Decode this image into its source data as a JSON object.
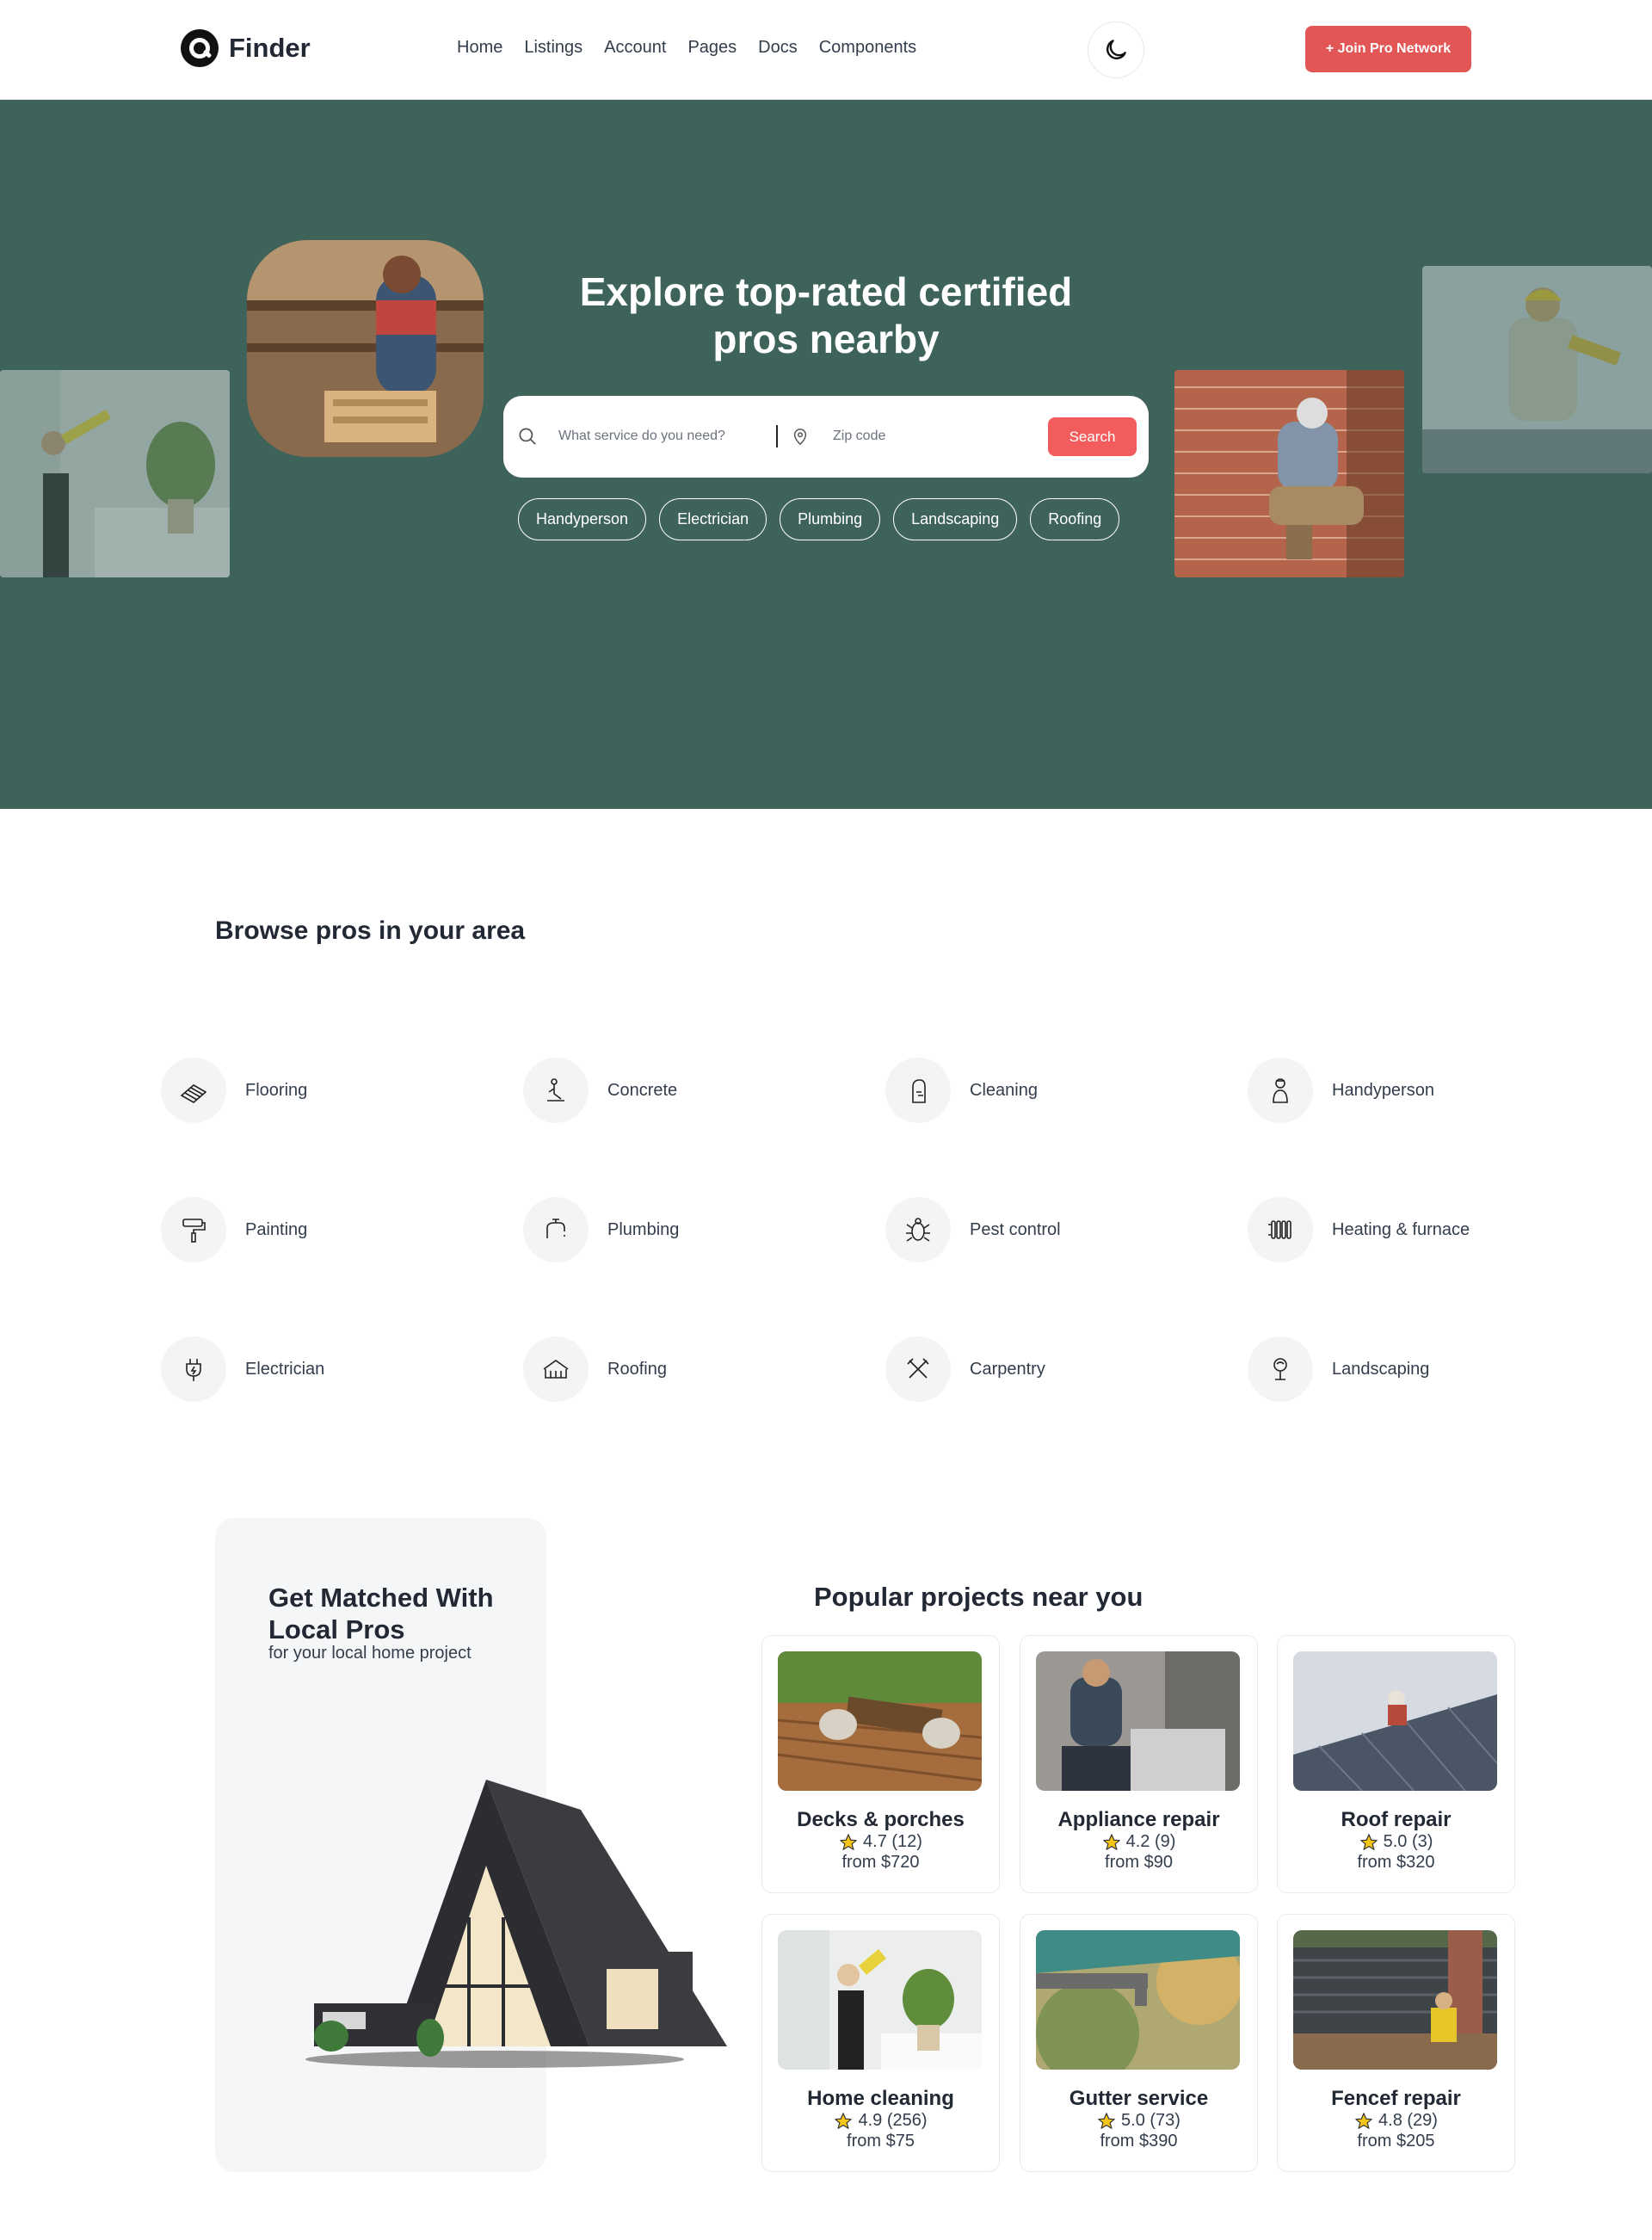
{
  "brand": {
    "name": "Finder"
  },
  "nav": {
    "items": [
      "Home",
      "Listings",
      "Account",
      "Pages",
      "Docs",
      "Components"
    ]
  },
  "header": {
    "join_label": "+ Join Pro Network",
    "theme_icon": "moon-icon"
  },
  "hero": {
    "title": "Explore top-rated certified pros nearby",
    "search_placeholder": "What service do you need?",
    "zip_placeholder": "Zip code",
    "search_label": "Search",
    "chips": [
      "Handyperson",
      "Electrician",
      "Plumbing",
      "Landscaping",
      "Roofing"
    ]
  },
  "browse": {
    "title": "Browse pros in your area",
    "categories": [
      {
        "label": "Flooring",
        "icon": "flooring-icon"
      },
      {
        "label": "Concrete",
        "icon": "concrete-icon"
      },
      {
        "label": "Cleaning",
        "icon": "cleaning-icon"
      },
      {
        "label": "Handyperson",
        "icon": "handyperson-icon"
      },
      {
        "label": "Painting",
        "icon": "paint-roller-icon"
      },
      {
        "label": "Plumbing",
        "icon": "faucet-icon"
      },
      {
        "label": "Pest control",
        "icon": "bug-icon"
      },
      {
        "label": "Heating & furnace",
        "icon": "radiator-icon"
      },
      {
        "label": "Electrician",
        "icon": "plug-icon"
      },
      {
        "label": "Roofing",
        "icon": "roof-icon"
      },
      {
        "label": "Carpentry",
        "icon": "tools-icon"
      },
      {
        "label": "Landscaping",
        "icon": "plant-icon"
      }
    ]
  },
  "match": {
    "title": "Get Matched With Local Pros",
    "subtitle": "for your local home project"
  },
  "projects": {
    "title": "Popular projects near you",
    "items": [
      {
        "name": "Decks & porches",
        "rating": "4.7 (12)",
        "price": "from $720"
      },
      {
        "name": "Appliance repair",
        "rating": "4.2 (9)",
        "price": "from $90"
      },
      {
        "name": "Roof repair",
        "rating": "5.0 (3)",
        "price": "from $320"
      },
      {
        "name": "Home cleaning",
        "rating": "4.9 (256)",
        "price": "from $75"
      },
      {
        "name": "Gutter service",
        "rating": "5.0 (73)",
        "price": "from $390"
      },
      {
        "name": "Fencef repair",
        "rating": "4.8 (29)",
        "price": "from $205"
      }
    ]
  },
  "colors": {
    "hero_bg": "#3e635b",
    "accent": "#e25656",
    "star": "#f5c518"
  }
}
